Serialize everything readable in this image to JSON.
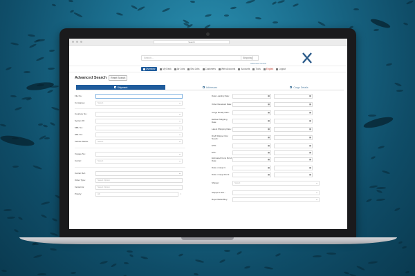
{
  "browser": {
    "url": "Search"
  },
  "header": {
    "search_placeholder": "Search...",
    "search_scope": "Shipping",
    "advanced_link": "Advanced search",
    "logo_text": "CARGO X STAR"
  },
  "nav": {
    "items": [
      {
        "label": "Overview",
        "active": true
      },
      {
        "label": "My Desk",
        "active": false
      },
      {
        "label": "Air Jobs",
        "active": false
      },
      {
        "label": "Sea Jobs",
        "active": false
      },
      {
        "label": "Customers",
        "active": false
      },
      {
        "label": "Web Accounts",
        "active": false
      },
      {
        "label": "Accounts",
        "active": false
      },
      {
        "label": "Tools",
        "active": false
      },
      {
        "label": "English",
        "active": false,
        "red": true
      },
      {
        "label": "Logout",
        "active": false
      }
    ]
  },
  "page": {
    "title": "Advanced Search",
    "reset_label": "Reset Search",
    "tabs": [
      {
        "label": "Shipment",
        "active": true
      },
      {
        "label": "Addresses",
        "active": false
      },
      {
        "label": "Cargo Details",
        "active": false
      }
    ]
  },
  "left_form": [
    {
      "label": "File No.:",
      "value": "",
      "type": "text",
      "active": true
    },
    {
      "label": "Consignee:",
      "value": "Select",
      "type": "select"
    },
    {
      "label": "Courtesy No.:",
      "value": "",
      "type": "select"
    },
    {
      "label": "System ID:",
      "value": "",
      "type": "select"
    },
    {
      "label": "MBL No.:",
      "value": "",
      "type": "select"
    },
    {
      "label": "HBL No.:",
      "value": "",
      "type": "select"
    },
    {
      "label": "Vehicle Status:",
      "value": "Select",
      "type": "select"
    },
    {
      "label": "Voyage No.:",
      "value": "",
      "type": "select"
    },
    {
      "label": "Carrier:",
      "value": "Select",
      "type": "select"
    },
    {
      "label": "Carrier Ref.:",
      "value": "",
      "type": "select"
    },
    {
      "label": "Order Type:",
      "value": "Select Option",
      "type": "text"
    },
    {
      "label": "Incoterms:",
      "value": "Select Option",
      "type": "text"
    },
    {
      "label": "Priority:",
      "value": "All",
      "type": "stepper"
    }
  ],
  "right_form": [
    {
      "label": "Date Loading Date:"
    },
    {
      "label": "Order Received Date:"
    },
    {
      "label": "Cargo Ready Date:"
    },
    {
      "label": "Earliest Shipping Date:"
    },
    {
      "label": "Latest Shipping Date:"
    },
    {
      "label": "Draft Shipper Doc Needs:"
    },
    {
      "label": "ETD:"
    },
    {
      "label": "ETA:"
    },
    {
      "label": "Estimated Cons Rcvd Date:"
    },
    {
      "label": "Date on Appt 1:"
    },
    {
      "label": "Date on Appt Del 2:"
    },
    {
      "label": "Shipper:",
      "single": true,
      "value": "Select"
    },
    {
      "label": "Shipper's Ref.:",
      "single": true,
      "value": ""
    },
    {
      "label": "Buyer/Seller/Buy:",
      "single": true,
      "value": ""
    }
  ],
  "icons": {
    "calendar": "calendar-icon"
  }
}
